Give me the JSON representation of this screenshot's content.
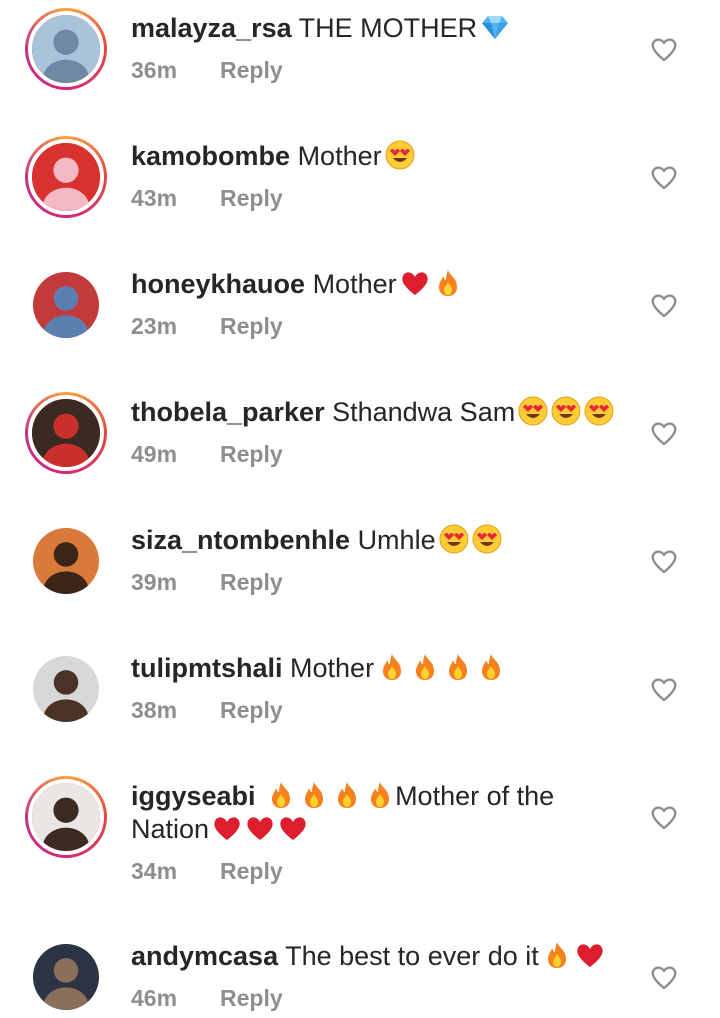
{
  "reply_label": "Reply",
  "comments": [
    {
      "username": "malayza_rsa",
      "text": "THE MOTHER",
      "emojis": [
        "gem"
      ],
      "text_after": "",
      "line2": "",
      "line2_emojis": [],
      "time": "36m",
      "ring": true,
      "avatar_colors": [
        "#a9c3da",
        "#6e8aa3"
      ]
    },
    {
      "username": "kamobombe",
      "text": "Mother",
      "emojis": [
        "heart-eyes"
      ],
      "text_after": "",
      "line2": "",
      "line2_emojis": [],
      "time": "43m",
      "ring": true,
      "avatar_colors": [
        "#d7322f",
        "#f2b9c5"
      ]
    },
    {
      "username": "honeykhauoe",
      "text": "Mother",
      "emojis": [
        "red-heart",
        "fire"
      ],
      "text_after": "",
      "line2": "",
      "line2_emojis": [],
      "time": "23m",
      "ring": false,
      "avatar_colors": [
        "#c23a3a",
        "#5a7fb0"
      ]
    },
    {
      "username": "thobela_parker",
      "text": "Sthandwa Sam",
      "emojis": [
        "heart-eyes",
        "heart-eyes",
        "heart-eyes"
      ],
      "text_after": "",
      "line2": "",
      "line2_emojis": [],
      "time": "49m",
      "ring": true,
      "avatar_colors": [
        "#3a2a22",
        "#c9302c"
      ]
    },
    {
      "username": "siza_ntombenhle",
      "text": "Umhle",
      "emojis": [
        "heart-eyes",
        "heart-eyes"
      ],
      "text_after": "",
      "line2": "",
      "line2_emojis": [],
      "time": "39m",
      "ring": false,
      "avatar_colors": [
        "#d97a3a",
        "#3b2418"
      ]
    },
    {
      "username": "tulipmtshali",
      "text": "Mother",
      "emojis": [
        "fire",
        "fire",
        "fire",
        "fire"
      ],
      "text_after": "",
      "line2": "",
      "line2_emojis": [],
      "time": "38m",
      "ring": false,
      "avatar_colors": [
        "#d8d8d8",
        "#4a3325"
      ]
    },
    {
      "username": "iggyseabi",
      "text": "",
      "emojis": [
        "fire",
        "fire",
        "fire",
        "fire"
      ],
      "text_after": "Mother of the",
      "line2": "Nation",
      "line2_emojis": [
        "red-heart",
        "red-heart",
        "red-heart"
      ],
      "time": "34m",
      "ring": true,
      "avatar_colors": [
        "#e9e6e4",
        "#3d2a22"
      ]
    },
    {
      "username": "andymcasa",
      "text": "The best to ever do it",
      "emojis": [
        "fire",
        "red-heart"
      ],
      "text_after": "",
      "line2": "",
      "line2_emojis": [],
      "time": "46m",
      "ring": false,
      "avatar_colors": [
        "#2c3342",
        "#8a6f5a"
      ]
    }
  ]
}
